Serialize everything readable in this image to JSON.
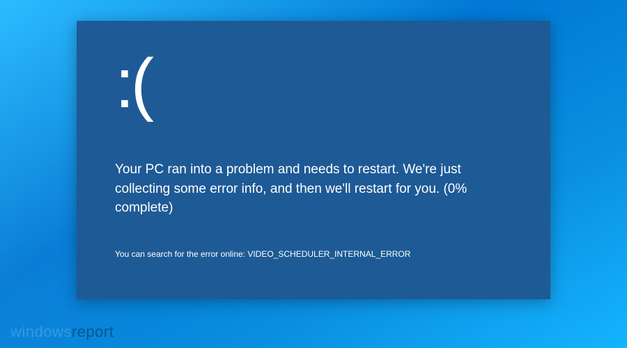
{
  "bsod": {
    "emoticon": ":(",
    "message": "Your PC ran into a problem and needs to restart. We're just collecting some error info, and then we'll restart for  you. (0% complete)",
    "hint_prefix": "You can search for the error online: ",
    "error_code": "VIDEO_SCHEDULER_INTERNAL_ERROR"
  },
  "watermark": {
    "part1": "windows",
    "part2": "report"
  }
}
